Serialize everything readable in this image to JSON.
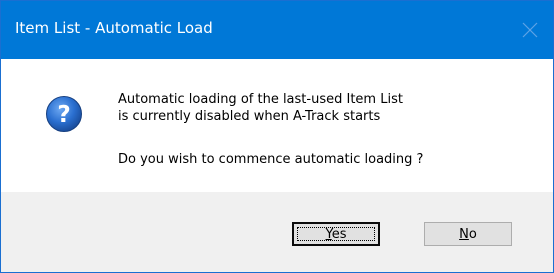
{
  "window": {
    "title": "Item List - Automatic Load"
  },
  "message": {
    "line1": "Automatic loading of the last-used Item List",
    "line2": "is currently disabled when A-Track starts",
    "question": "Do you wish to commence automatic loading ?"
  },
  "buttons": {
    "yes": {
      "label": "Yes",
      "mnemonic": "Y"
    },
    "no": {
      "label": "No",
      "mnemonic": "N"
    }
  },
  "colors": {
    "titlebar": "#0078d7",
    "footer": "#f0f0f0",
    "icon": "#1f5fbf"
  },
  "icons": {
    "question": "question-icon",
    "close": "close-icon"
  }
}
